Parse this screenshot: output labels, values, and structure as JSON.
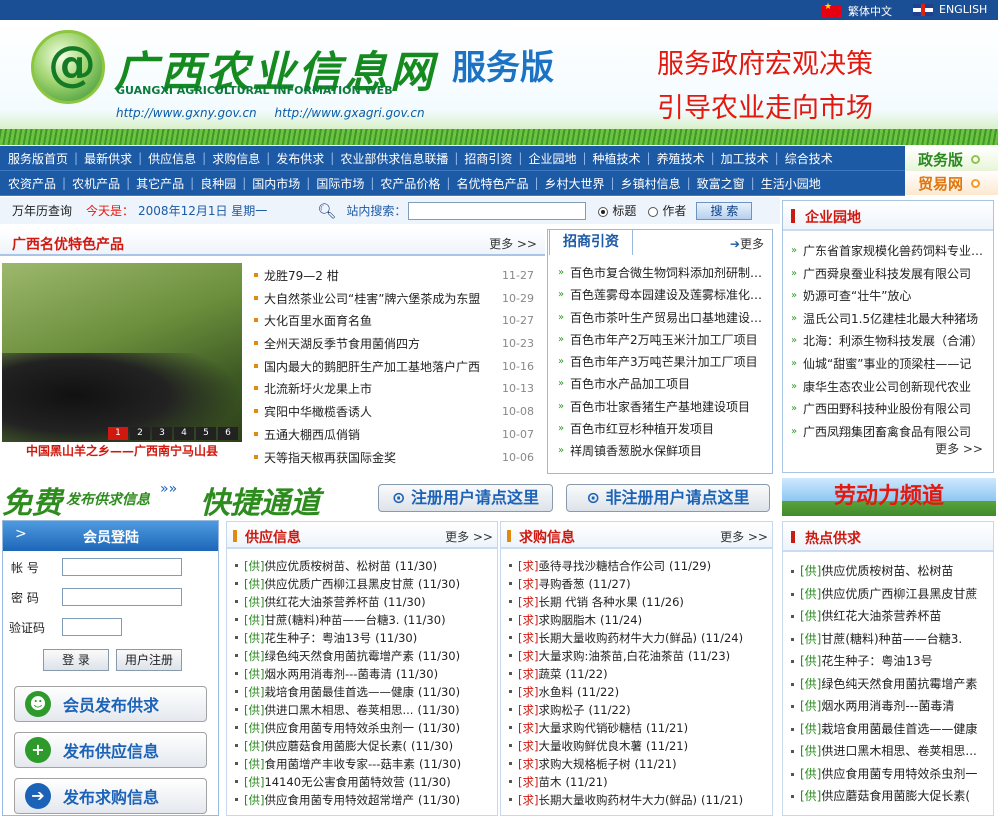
{
  "topbar": {
    "lang_cn": "繁体中文",
    "lang_en": "ENGLISH"
  },
  "header": {
    "brand_cn": "广西农业信息网",
    "brand_en": "GUANGXI AGRICULTURAL INFORMATION WEB",
    "url1": "http://www.gxny.gov.cn",
    "url2": "http://www.gxagri.gov.cn",
    "edition": "服务版",
    "slogan1": "服务政府宏观决策",
    "slogan2": "引导农业走向市场"
  },
  "nav": {
    "row1": [
      "服务版首页",
      "最新供求",
      "供应信息",
      "求购信息",
      "发布供求",
      "农业部供求信息联播",
      "招商引资",
      "企业园地",
      "种植技术",
      "养殖技术",
      "加工技术",
      "综合技术"
    ],
    "row2": [
      "农资产品",
      "农机产品",
      "其它产品",
      "良种园",
      "国内市场",
      "国际市场",
      "农产品价格",
      "名优特色产品",
      "乡村大世界",
      "乡镇村信息",
      "致富之窗",
      "生活小园地"
    ],
    "side1": "政务版",
    "side2": "贸易网"
  },
  "search": {
    "calendar": "万年历查询",
    "today_label": "今天是：",
    "today": "2008年12月1日 星期一",
    "label": "站内搜索：",
    "opt1": "标题",
    "opt2": "作者",
    "button": "搜 索"
  },
  "featured": {
    "title": "广西名优特色产品",
    "more": "更多 >>",
    "caption": "中国黑山羊之乡——广西南宁马山县",
    "pages": [
      "1",
      "2",
      "3",
      "4",
      "5",
      "6"
    ],
    "items": [
      {
        "t": "龙胜79—2  柑",
        "d": "11-27"
      },
      {
        "t": "大自然茶业公司“桂害”牌六堡茶成为东盟",
        "d": "10-29"
      },
      {
        "t": "大化百里水面育名鱼",
        "d": "10-27"
      },
      {
        "t": "全州天湖反季节食用菌俏四方",
        "d": "10-23"
      },
      {
        "t": "国内最大的鹅肥肝生产加工基地落户广西",
        "d": "10-16"
      },
      {
        "t": "北流新圩火龙果上市",
        "d": "10-13"
      },
      {
        "t": "宾阳中华橄榄香诱人",
        "d": "10-08"
      },
      {
        "t": "五通大棚西瓜俏销",
        "d": "10-07"
      },
      {
        "t": "天等指天椒再获国际金奖",
        "d": "10-06"
      }
    ]
  },
  "invest": {
    "title": "招商引资",
    "more": "更多",
    "items": [
      "百色市复合微生物饲料添加剂研制与开发",
      "百色莲雾母本园建设及莲雾标准化种植",
      "百色市茶叶生产贸易出口基地建设项目",
      "百色市年产2万吨玉米汁加工厂项目",
      "百色市年产3万吨芒果汁加工厂项目",
      "百色市水产品加工项目",
      "百色市壮家香猪生产基地建设项目",
      "百色市红豆杉种植开发项目",
      "祥周镇香葱脱水保鲜项目"
    ]
  },
  "enterprise": {
    "title": "企业园地",
    "more": "更多 >>",
    "items": [
      "广东省首家规模化兽药饲料专业市场",
      "广西舜泉蚕业科技发展有限公司",
      "奶源可查“壮牛”放心",
      "温氏公司1.5亿建桂北最大种猪场",
      "北海：利添生物科技发展（合浦）",
      "仙城“甜蜜”事业的顶梁柱——记",
      "康华生态农业公司创新现代农业",
      "广西田野科技种业股份有限公司",
      "广西凤翔集团畜禽食品有限公司"
    ]
  },
  "banner": {
    "free": "免费",
    "sub": "发布供求信息",
    "fast": "快捷通道",
    "reg": "注册用户请点这里",
    "unreg": "非注册用户请点这里",
    "labor": "劳动力频道"
  },
  "login": {
    "title": "会员登陆",
    "user": "帐  号",
    "pass": "密  码",
    "code": "验证码",
    "login": "登  录",
    "register": "用户注册",
    "pub1": "会员发布供求",
    "pub2": "发布供应信息",
    "pub3": "发布求购信息"
  },
  "supply": {
    "title": "供应信息",
    "more": "更多 >>",
    "tag": "[供]",
    "items": [
      {
        "t": "供应优质桉树苗、松树苗",
        "d": "(11/30)"
      },
      {
        "t": "供应优质广西柳江县黑皮甘蔗",
        "d": "(11/30)"
      },
      {
        "t": "供红花大油茶营养杯苗",
        "d": "(11/30)"
      },
      {
        "t": "甘蔗(糖料)种苗——台糖3.",
        "d": "(11/30)"
      },
      {
        "t": "花生种子：粤油13号",
        "d": "(11/30)"
      },
      {
        "t": "绿色纯天然食用菌抗霉增产素",
        "d": "(11/30)"
      },
      {
        "t": "烟水两用消毒剂---菌毒清",
        "d": "(11/30)"
      },
      {
        "t": "栽培食用菌最佳首选——健康",
        "d": "(11/30)"
      },
      {
        "t": "供进口黑木相思、卷荚相思...",
        "d": "(11/30)"
      },
      {
        "t": "供应食用菌专用特效杀虫剂一",
        "d": "(11/30)"
      },
      {
        "t": "供应蘑菇食用菌膨大促长素(",
        "d": "(11/30)"
      },
      {
        "t": "食用菌增产丰收专家---菇丰素",
        "d": "(11/30)"
      },
      {
        "t": "14140无公害食用菌特效营",
        "d": "(11/30)"
      },
      {
        "t": "供应食用菌专用特效超常增产",
        "d": "(11/30)"
      }
    ]
  },
  "demand": {
    "title": "求购信息",
    "more": "更多 >>",
    "tag": "[求]",
    "items": [
      {
        "t": "亟待寻找沙糖桔合作公司",
        "d": "(11/29)"
      },
      {
        "t": "寻购香葱",
        "d": "(11/27)"
      },
      {
        "t": "长期 代销 各种水果",
        "d": "(11/26)"
      },
      {
        "t": "求购胭脂木",
        "d": "(11/24)"
      },
      {
        "t": "长期大量收购药材牛大力(鲜品)",
        "d": "(11/24)"
      },
      {
        "t": "大量求购:油茶苗,白花油茶苗",
        "d": "(11/23)"
      },
      {
        "t": "蔬菜",
        "d": "(11/22)"
      },
      {
        "t": "水鱼料",
        "d": "(11/22)"
      },
      {
        "t": "求购松子",
        "d": "(11/22)"
      },
      {
        "t": "大量求购代销砂糖桔",
        "d": "(11/21)"
      },
      {
        "t": "大量收购鲜优良木薯",
        "d": "(11/21)"
      },
      {
        "t": "求购大规格栀子树",
        "d": "(11/21)"
      },
      {
        "t": "苗木",
        "d": "(11/21)"
      },
      {
        "t": "长期大量收购药材牛大力(鲜品)",
        "d": "(11/21)"
      }
    ]
  },
  "hot": {
    "title": "热点供求",
    "tag": "[供]",
    "items": [
      "供应优质桉树苗、松树苗",
      "供应优质广西柳江县黑皮甘蔗",
      "供红花大油茶营养杯苗",
      "甘蔗(糖料)种苗——台糖3.",
      "花生种子：粤油13号",
      "绿色纯天然食用菌抗霉增产素",
      "烟水两用消毒剂---菌毒清",
      "栽培食用菌最佳首选——健康",
      "供进口黑木相思、卷荚相思...",
      "供应食用菌专用特效杀虫剂一",
      "供应蘑菇食用菌膨大促长素("
    ]
  }
}
